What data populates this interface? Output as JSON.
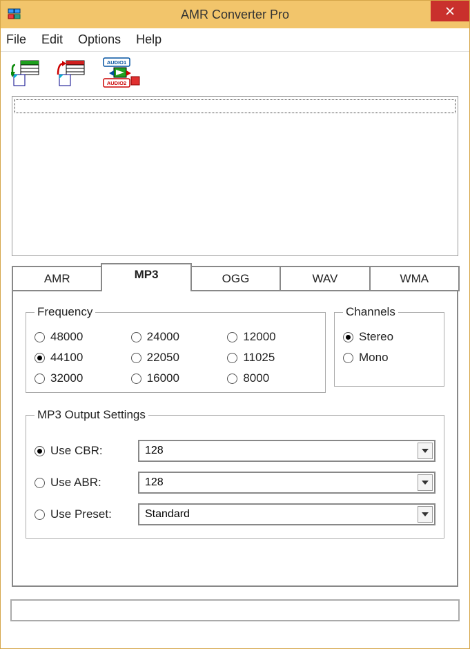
{
  "titlebar": {
    "title": "AMR Converter Pro"
  },
  "menubar": {
    "file": "File",
    "edit": "Edit",
    "options": "Options",
    "help": "Help"
  },
  "toolbar": {
    "btn1_name": "add-files-icon",
    "btn2_name": "remove-files-icon",
    "btn3_name": "convert-audio-icon",
    "audio1_label": "AUDIO1",
    "audio2_label": "AUDIO2"
  },
  "tabs": {
    "amr": "AMR",
    "mp3": "MP3",
    "ogg": "OGG",
    "wav": "WAV",
    "wma": "WMA",
    "active": "mp3"
  },
  "frequency": {
    "legend": "Frequency",
    "options": [
      "48000",
      "24000",
      "12000",
      "44100",
      "22050",
      "11025",
      "32000",
      "16000",
      "8000"
    ],
    "selected": "44100"
  },
  "channels": {
    "legend": "Channels",
    "options": [
      "Stereo",
      "Mono"
    ],
    "selected": "Stereo"
  },
  "output": {
    "legend": "MP3 Output Settings",
    "cbr_label": "Use CBR:",
    "cbr_value": "128",
    "abr_label": "Use ABR:",
    "abr_value": "128",
    "preset_label": "Use Preset:",
    "preset_value": "Standard",
    "selected": "cbr"
  }
}
